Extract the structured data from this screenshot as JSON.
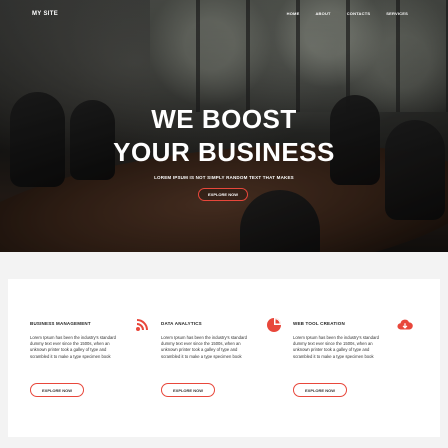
{
  "header": {
    "site_title": "MY SITE",
    "nav": [
      "HOME",
      "ABOUT",
      "CONTACTS",
      "SERVICES"
    ]
  },
  "hero": {
    "headline_line1": "WE BOOST",
    "headline_line2": "YOUR BUSINESS",
    "tagline": "LOREM IPSUM IS NOT SIMPLY RANDOM TEXT THAT MAKES",
    "button_label": "EXPLORE NOW"
  },
  "services": [
    {
      "title": "BUSINESS MANAGEMENT",
      "icon": "wifi-signal-icon",
      "text": "Lorem Ipsum has been the industry's standard dummy text ever since the 1500s, when an unknown printer took a galley of type and scrambled it to make a type specimen book",
      "button_label": "EXPLORE NOW"
    },
    {
      "title": "DATA ANALYTICS",
      "icon": "pie-chart-icon",
      "text": "Lorem Ipsum has been the industry's standard dummy text ever since the 1500s, when an unknown printer took a galley of type and scrambled it to make a type specimen book",
      "button_label": "EXPLORE NOW"
    },
    {
      "title": "WEB TOOL CREATION",
      "icon": "cloud-download-icon",
      "text": "Lorem Ipsum has been the industry's standard dummy text ever since the 1500s, when an unknown printer took a galley of type and scrambled it to make a type specimen book",
      "button_label": "EXPLORE NOW"
    }
  ],
  "colors": {
    "accent": "#e8473b",
    "hero_text": "#ffffff",
    "body_text": "#333333",
    "panel_bg": "#ffffff",
    "page_bg": "#f3f3f3"
  }
}
